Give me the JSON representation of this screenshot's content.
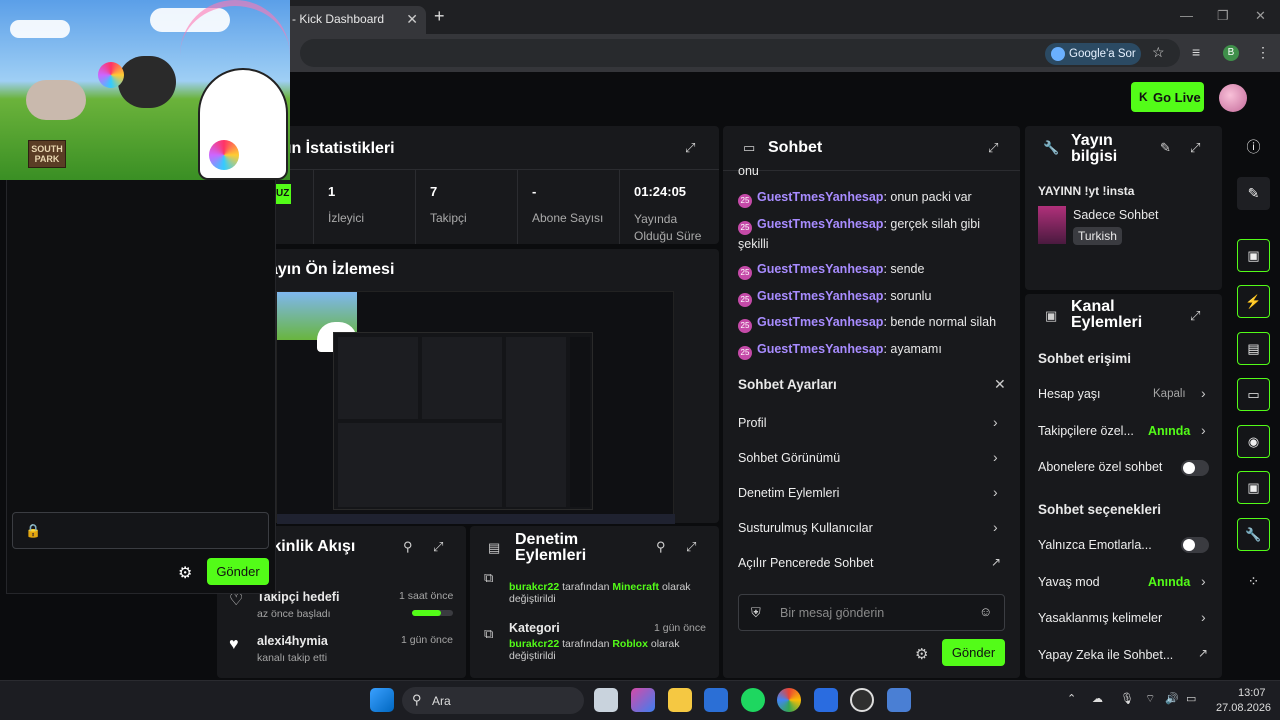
{
  "browser": {
    "tab_title": "- Kick Dashboard",
    "tab_close": "✕",
    "new_tab": "+",
    "google_button": "Google'a Sor",
    "profile_initial": "B",
    "window_controls": [
      "—",
      "❐",
      "✕"
    ]
  },
  "header": {
    "go_live": "Go Live",
    "go_live_logo": "K"
  },
  "stream_overlay": {
    "sign_text": "SOUTH PARK"
  },
  "left_chat": {
    "send_label": "Gönder"
  },
  "stats": {
    "title": "ın İstatistikleri",
    "badge": "UZ",
    "items": [
      {
        "value": "1",
        "label": "İzleyici"
      },
      {
        "value": "7",
        "label": "Takipçi"
      },
      {
        "value": "-",
        "label": "Abone Sayısı"
      },
      {
        "value": "01:24:05",
        "label": "Yayında Olduğu Süre"
      }
    ]
  },
  "preview": {
    "title": "ayın Ön İzlemesi"
  },
  "activity": {
    "title": "tkinlik Akışı",
    "items": [
      {
        "title": "Takipçi hedefi",
        "subtitle": "az önce başladı",
        "time": "1 saat önce",
        "progress": 0.7
      },
      {
        "title": "alexi4hymia",
        "subtitle": "kanalı takip etti",
        "time": "1 gün önce"
      }
    ]
  },
  "moderation": {
    "title": "Denetim Eylemleri",
    "items": [
      {
        "user": "burakcr22",
        "mid": "tarafından",
        "game": "Minecraft",
        "tail": "olarak",
        "line2": "değiştirildi"
      },
      {
        "title": "Kategori",
        "time": "1 gün önce",
        "user": "burakcr22",
        "mid": "tarafından",
        "game": "Roblox",
        "tail": "olarak",
        "line2": "değiştirildi"
      }
    ]
  },
  "chat": {
    "title": "Sohbet",
    "partial_top": "onu",
    "badge": "25",
    "messages": [
      {
        "user": "GuestTmesYanhesap",
        "text": ": onun packi var"
      },
      {
        "user": "GuestTmesYanhesap",
        "text": ": gerçek silah gibi şekilli"
      },
      {
        "user": "GuestTmesYanhesap",
        "text": ": sende"
      },
      {
        "user": "GuestTmesYanhesap",
        "text": ": sorunlu"
      },
      {
        "user": "GuestTmesYanhesap",
        "text": ": bende normal silah"
      },
      {
        "user": "GuestTmesYanhesap",
        "text": ": ayamamı"
      }
    ],
    "settings_title": "Sohbet Ayarları",
    "settings": [
      "Profil",
      "Sohbet Görünümü",
      "Denetim Eylemleri",
      "Susturulmuş Kullanıcılar",
      "Açılır Pencerede Sohbet"
    ],
    "placeholder": "Bir mesaj gönderin",
    "send_label": "Gönder"
  },
  "stream_info": {
    "title_line1": "Yayın",
    "title_line2": "bilgisi",
    "stream_title": "YAYINN !yt !insta",
    "category": "Sadece Sohbet",
    "language": "Turkish"
  },
  "channel_actions": {
    "title_line1": "Kanal",
    "title_line2": "Eylemleri",
    "chat_access": "Sohbet erişimi",
    "account_age_label": "Hesap yaşı",
    "account_age_value": "Kapalı",
    "followers_label": "Takipçilere özel...",
    "followers_value": "Anında",
    "subs_label": "Abonelere özel sohbet",
    "chat_options": "Sohbet seçenekleri",
    "emote_label": "Yalnızca Emotlarla...",
    "slow_label": "Yavaş mod",
    "slow_value": "Anında",
    "banned_words": "Yasaklanmış kelimeler",
    "ai_label": "Yapay Zeka ile Sohbet..."
  },
  "taskbar": {
    "search": "Ara",
    "time": "13:07",
    "date": "27.08.2026"
  },
  "colors": {
    "accent": "#53fc18",
    "username": "#a88cff",
    "panel": "#18191c"
  }
}
